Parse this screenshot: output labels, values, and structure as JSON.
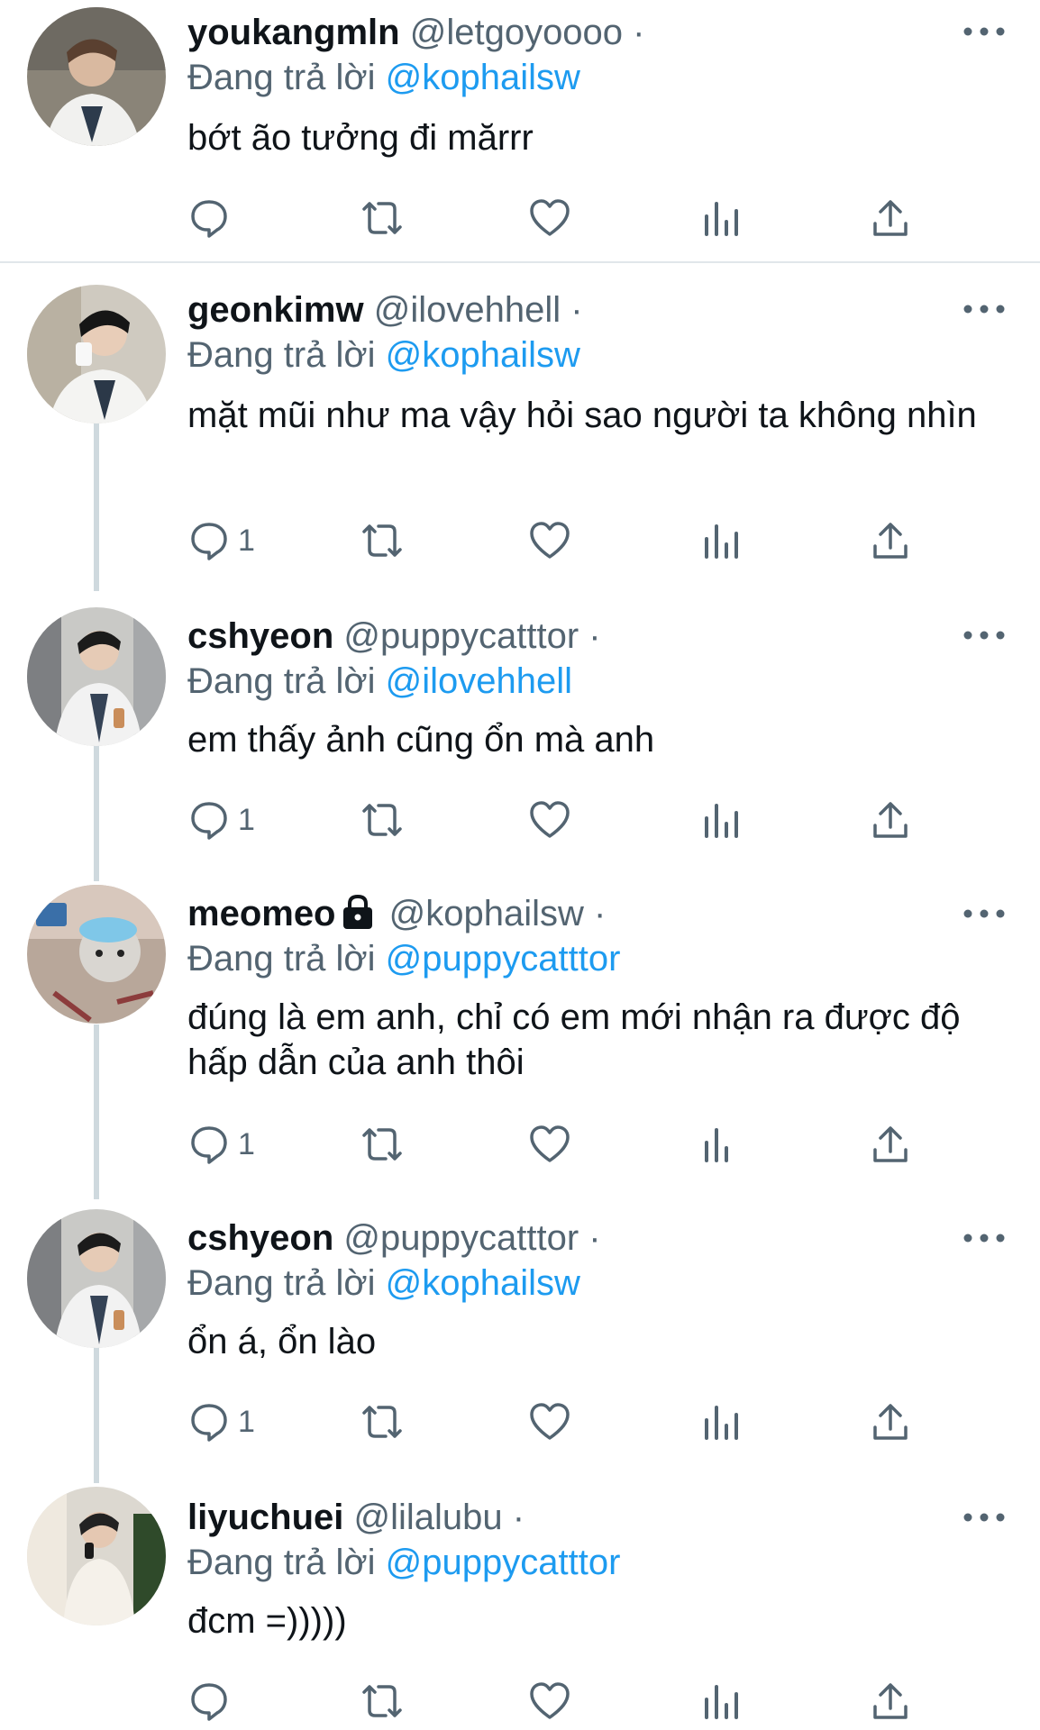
{
  "colors": {
    "text": "#0f1419",
    "muted": "#536471",
    "accent": "#1d9bf0",
    "thread": "#cfd9de"
  },
  "icons": [
    "reply-icon",
    "retweet-icon",
    "like-icon",
    "views-icon",
    "share-icon",
    "more-icon",
    "lock-icon"
  ],
  "tweets": [
    {
      "name": "youkangmln",
      "handle": "@letgoyoooo",
      "dot": "·",
      "reply_prefix": "Đang trả lời",
      "reply_to": "@kophailsw",
      "text": "bớt ão tưởng đi mărrr",
      "reply_count": ""
    },
    {
      "name": "geonkimw",
      "handle": "@ilovehhell",
      "dot": "·",
      "reply_prefix": "Đang trả lời",
      "reply_to": "@kophailsw",
      "text": "mặt mũi như ma vậy hỏi sao người ta không nhìn",
      "reply_count": "1"
    },
    {
      "name": "cshyeon",
      "handle": "@puppycatttor",
      "dot": "·",
      "reply_prefix": "Đang trả lời",
      "reply_to": "@ilovehhell",
      "text": "em thấy ảnh cũng ổn mà anh",
      "reply_count": "1"
    },
    {
      "name": "meomeo",
      "handle": "@kophailsw",
      "dot": "·",
      "reply_prefix": "Đang trả lời",
      "reply_to": "@puppycatttor",
      "text": "đúng là em anh, chỉ có em mới nhận ra được độ hấp dẫn của anh thôi",
      "reply_count": "1",
      "protected": true
    },
    {
      "name": "cshyeon",
      "handle": "@puppycatttor",
      "dot": "·",
      "reply_prefix": "Đang trả lời",
      "reply_to": "@kophailsw",
      "text": "ổn á, ổn lào",
      "reply_count": "1"
    },
    {
      "name": "liyuchuei",
      "handle": "@lilalubu",
      "dot": "·",
      "reply_prefix": "Đang trả lời",
      "reply_to": "@puppycatttor",
      "text": "đcm =)))))",
      "reply_count": ""
    }
  ]
}
